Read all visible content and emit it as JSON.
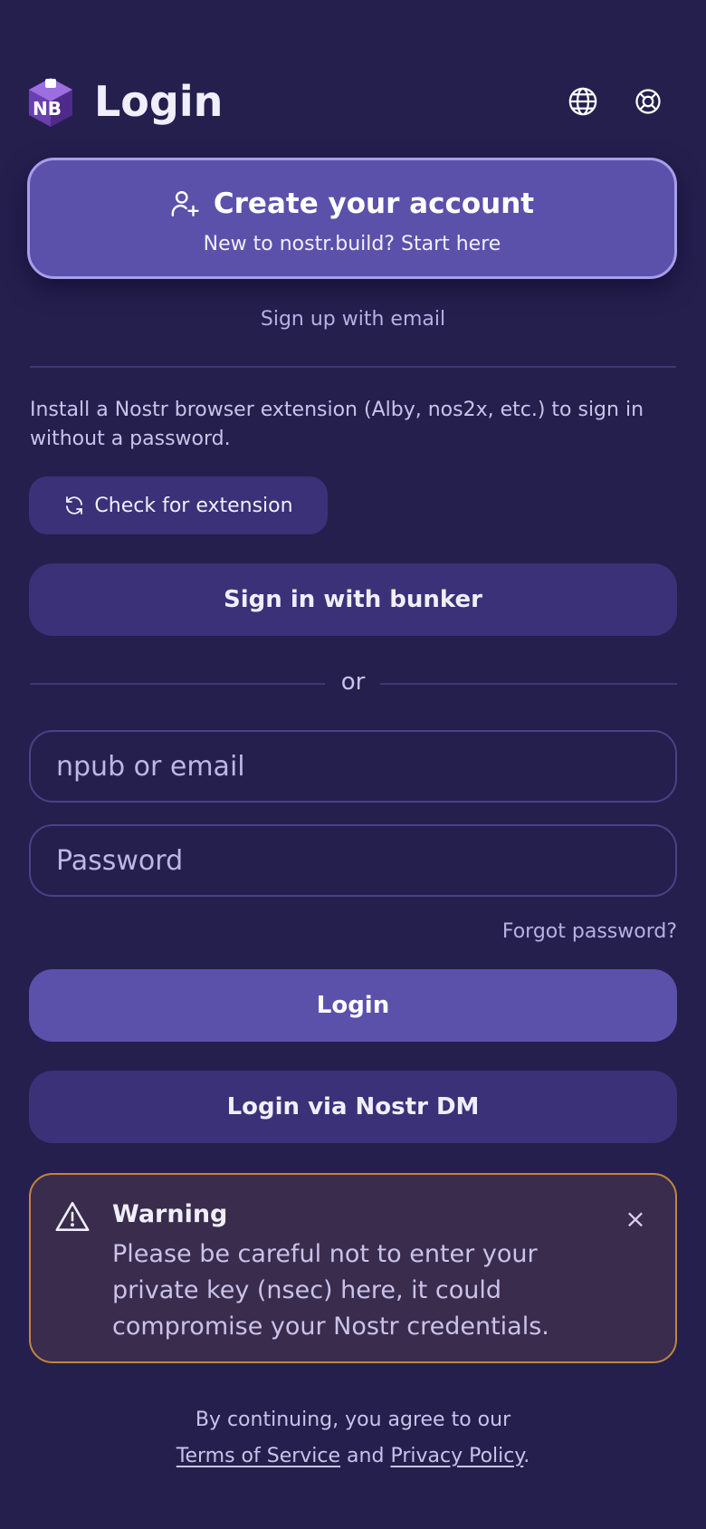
{
  "header": {
    "logo_text": "NB",
    "title": "Login",
    "language_icon": "globe-icon",
    "help_icon": "lifebuoy-icon"
  },
  "create_account": {
    "icon": "user-plus-icon",
    "title": "Create your account",
    "subtitle": "New to nostr.build? Start here"
  },
  "signup_email_link": "Sign up with email",
  "extension": {
    "description": "Install a Nostr browser extension (Alby, nos2x, etc.) to sign in without a password.",
    "check_button": "Check for extension",
    "check_icon": "refresh-icon"
  },
  "bunker_button": "Sign in with bunker",
  "divider_text": "or",
  "form": {
    "identity_placeholder": "npub or email",
    "password_placeholder": "Password",
    "forgot_link": "Forgot password?",
    "login_button": "Login",
    "nostr_dm_button": "Login via Nostr DM"
  },
  "warning": {
    "icon": "warning-triangle-icon",
    "title": "Warning",
    "body": "Please be careful not to enter your private key (nsec) here, it could compromise your Nostr credentials.",
    "close": "×"
  },
  "footer": {
    "prefix": "By continuing, you agree to our",
    "terms": "Terms of Service",
    "and": "and",
    "privacy": "Privacy Policy",
    "suffix": "."
  },
  "colors": {
    "background": "#251f4e",
    "primary": "#5b51ab",
    "secondary": "#3a3178",
    "warning_border": "#c08640"
  }
}
